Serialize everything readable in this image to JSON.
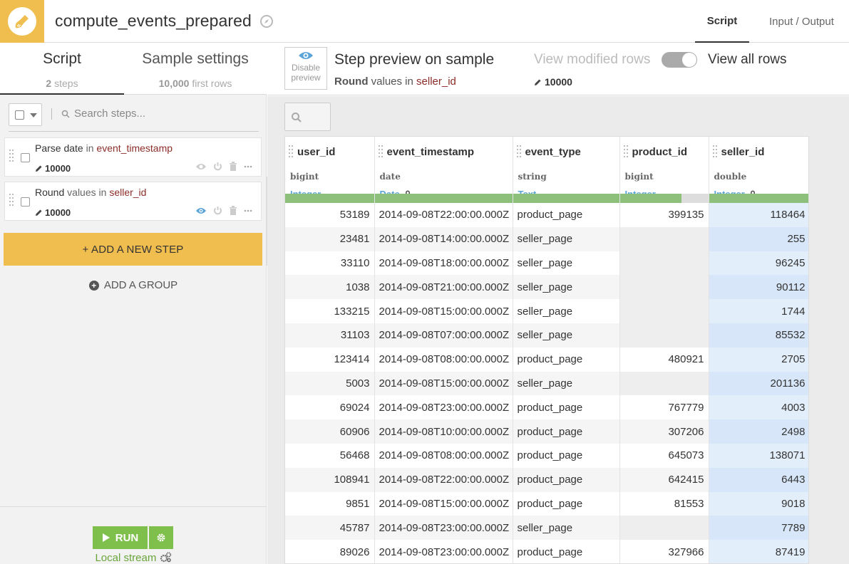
{
  "header": {
    "title": "compute_events_prepared",
    "tabs": [
      {
        "label": "Script",
        "active": true
      },
      {
        "label": "Input / Output",
        "active": false
      }
    ]
  },
  "left": {
    "tabs": [
      {
        "label": "Script",
        "sub_bold": "2",
        "sub_rest": "steps"
      },
      {
        "label": "Sample settings",
        "sub_bold": "10,000",
        "sub_rest": "first rows"
      }
    ],
    "search_placeholder": "Search steps...",
    "steps": [
      {
        "action": "Parse date",
        "joiner": "in",
        "column": "event_timestamp",
        "count": "10000",
        "eye_active": false
      },
      {
        "action": "Round",
        "joiner": "values in",
        "column": "seller_id",
        "count": "10000",
        "eye_active": true
      }
    ],
    "add_step_label": "+ ADD A NEW STEP",
    "add_group_label": "ADD A GROUP",
    "run_label": "RUN",
    "engine_label": "Local stream"
  },
  "preview": {
    "disable_label_1": "Disable",
    "disable_label_2": "preview",
    "title": "Step preview on sample",
    "sub_bold": "Round",
    "sub_mid": "values in",
    "sub_col": "seller_id",
    "view_modified": "View modified rows",
    "view_all": "View all rows",
    "modified_count": "10000"
  },
  "table": {
    "columns": [
      {
        "name": "user_id",
        "type": "bigint",
        "meaning": "Integer",
        "locked": false,
        "valid_fraction": 1.0
      },
      {
        "name": "event_timestamp",
        "type": "date",
        "meaning": "Date",
        "locked": true,
        "valid_fraction": 1.0
      },
      {
        "name": "event_type",
        "type": "string",
        "meaning": "Text",
        "locked": false,
        "valid_fraction": 1.0
      },
      {
        "name": "product_id",
        "type": "bigint",
        "meaning": "Integer",
        "locked": false,
        "valid_fraction": 0.7
      },
      {
        "name": "seller_id",
        "type": "double",
        "meaning": "Integer",
        "locked": true,
        "valid_fraction": 1.0
      }
    ],
    "rows": [
      [
        "53189",
        "2014-09-08T22:00:00.000Z",
        "product_page",
        "399135",
        "118464"
      ],
      [
        "23481",
        "2014-09-08T14:00:00.000Z",
        "seller_page",
        "",
        "255"
      ],
      [
        "33110",
        "2014-09-08T18:00:00.000Z",
        "seller_page",
        "",
        "96245"
      ],
      [
        "1038",
        "2014-09-08T21:00:00.000Z",
        "seller_page",
        "",
        "90112"
      ],
      [
        "133215",
        "2014-09-08T15:00:00.000Z",
        "seller_page",
        "",
        "1744"
      ],
      [
        "31103",
        "2014-09-08T07:00:00.000Z",
        "seller_page",
        "",
        "85532"
      ],
      [
        "123414",
        "2014-09-08T08:00:00.000Z",
        "product_page",
        "480921",
        "2705"
      ],
      [
        "5003",
        "2014-09-08T15:00:00.000Z",
        "seller_page",
        "",
        "201136"
      ],
      [
        "69024",
        "2014-09-08T23:00:00.000Z",
        "product_page",
        "767779",
        "4003"
      ],
      [
        "60906",
        "2014-09-08T10:00:00.000Z",
        "product_page",
        "307206",
        "2498"
      ],
      [
        "56468",
        "2014-09-08T08:00:00.000Z",
        "product_page",
        "645073",
        "138071"
      ],
      [
        "108941",
        "2014-09-08T22:00:00.000Z",
        "product_page",
        "642415",
        "6443"
      ],
      [
        "9851",
        "2014-09-08T15:00:00.000Z",
        "product_page",
        "81553",
        "9018"
      ],
      [
        "45787",
        "2014-09-08T23:00:00.000Z",
        "seller_page",
        "",
        "7789"
      ],
      [
        "89026",
        "2014-09-08T23:00:00.000Z",
        "product_page",
        "327966",
        "87419"
      ]
    ]
  },
  "colors": {
    "accent": "#f0be4f",
    "run_green": "#7fbf4c",
    "column_ref": "#8b2d28",
    "meaning_blue": "#5ba4d8",
    "valid_bar": "#8cc07b"
  }
}
